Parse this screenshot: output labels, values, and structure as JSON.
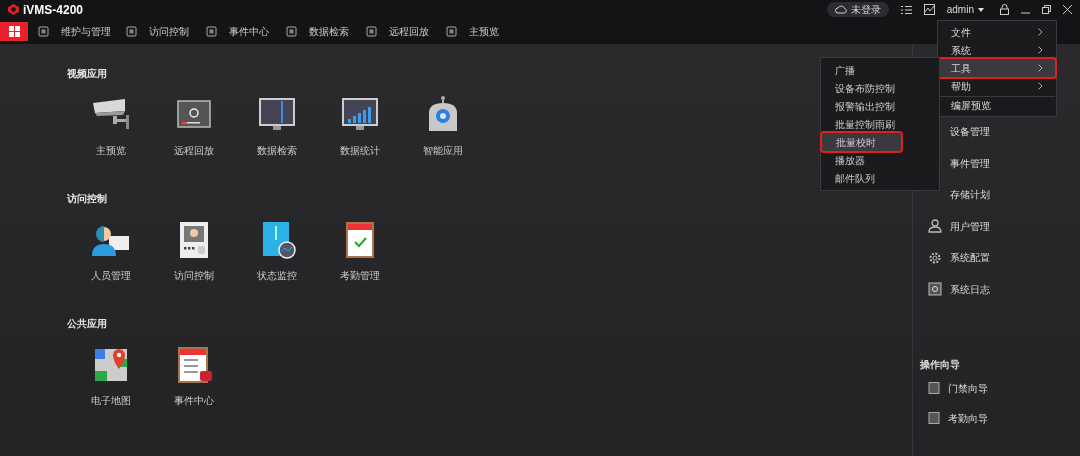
{
  "app": {
    "title": "iVMS-4200"
  },
  "nav": [
    {
      "label": "维护与管理",
      "selected": false
    },
    {
      "label": "访问控制",
      "selected": false
    },
    {
      "label": "事件中心",
      "selected": false
    },
    {
      "label": "数据检索",
      "selected": false
    },
    {
      "label": "远程回放",
      "selected": false
    },
    {
      "label": "主预览",
      "selected": false
    }
  ],
  "home_selected": true,
  "cloud": "未登录",
  "user": "admin",
  "sections": [
    {
      "title": "视频应用",
      "items": [
        "主预览",
        "远程回放",
        "数据检索",
        "数据统计",
        "智能应用"
      ]
    },
    {
      "title": "访问控制",
      "items": [
        "人员管理",
        "访问控制",
        "状态监控",
        "考勤管理"
      ]
    },
    {
      "title": "公共应用",
      "items": [
        "电子地图",
        "事件中心"
      ]
    }
  ],
  "side_items": [
    "设备管理",
    "事件管理",
    "存储计划",
    "用户管理",
    "系统配置",
    "系统日志"
  ],
  "guide": {
    "title": "操作向导",
    "items": [
      "门禁向导",
      "考勤向导"
    ]
  },
  "menu": [
    {
      "label": "文件",
      "submenu": true,
      "selected": false
    },
    {
      "label": "系统",
      "submenu": true,
      "selected": false
    },
    {
      "label": "工具",
      "submenu": true,
      "selected": true
    },
    {
      "label": "帮助",
      "submenu": true,
      "selected": false
    },
    {
      "label": "编屏预览",
      "submenu": false,
      "selected": false
    }
  ],
  "submenu": [
    {
      "label": "广播",
      "selected": false
    },
    {
      "label": "设备布防控制",
      "selected": false
    },
    {
      "label": "报警输出控制",
      "selected": false
    },
    {
      "label": "批量控制雨刷",
      "selected": false
    },
    {
      "label": "批量校时",
      "selected": true
    },
    {
      "label": "播放器",
      "selected": false
    },
    {
      "label": "邮件队列",
      "selected": false
    }
  ]
}
